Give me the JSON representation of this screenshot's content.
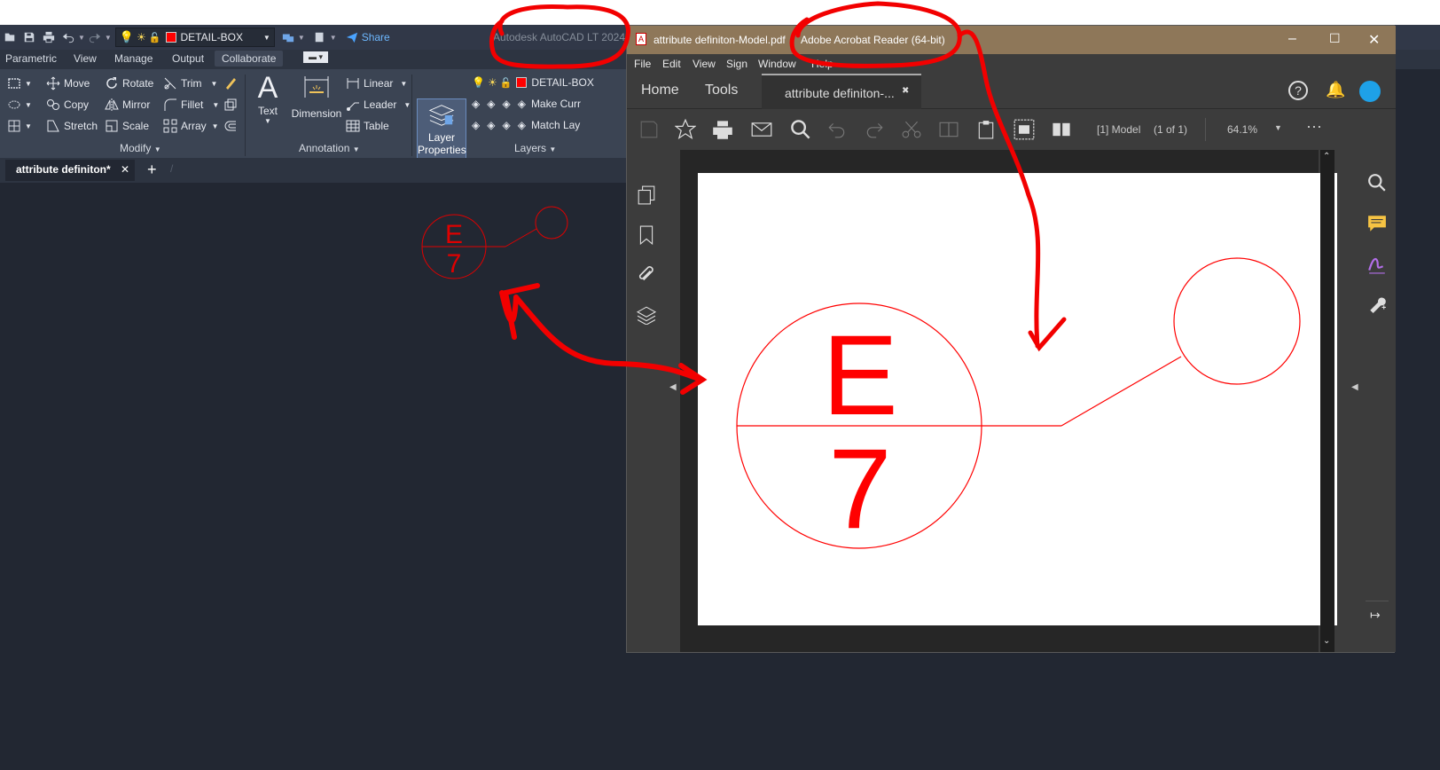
{
  "autocad": {
    "layer_name": "DETAIL-BOX",
    "share_label": "Share",
    "window_title": "Autodesk AutoCAD LT 2024",
    "tabs": [
      "Parametric",
      "View",
      "Manage",
      "Output",
      "Collaborate"
    ],
    "modify": {
      "move": "Move",
      "rotate": "Rotate",
      "trim": "Trim",
      "copy": "Copy",
      "mirror": "Mirror",
      "fillet": "Fillet",
      "stretch": "Stretch",
      "scale": "Scale",
      "array": "Array",
      "panel_title": "Modify"
    },
    "annotation": {
      "text": "Text",
      "dimension": "Dimension",
      "linear": "Linear",
      "leader": "Leader",
      "table": "Table",
      "panel_title": "Annotation"
    },
    "layers": {
      "layer_properties": "Layer Properties",
      "layer_properties_line1": "Layer",
      "layer_properties_line2": "Properties",
      "current_layer": "DETAIL-BOX",
      "make_current": "Make Curr",
      "match_layer": "Match Lay",
      "panel_title": "Layers"
    },
    "document_tab": "attribute definiton*",
    "drawing": {
      "top_text": "E",
      "bottom_text": "7"
    }
  },
  "acrobat": {
    "file_title": "attribute definiton-Model.pdf",
    "app_title": "Adobe Acrobat Reader (64-bit)",
    "menu": [
      "File",
      "Edit",
      "View",
      "Sign",
      "Window",
      "Help"
    ],
    "tabs": {
      "home": "Home",
      "tools": "Tools",
      "document": "attribute definiton-..."
    },
    "page_label": "[1] Model",
    "page_count": "(1 of 1)",
    "zoom": "64.1%",
    "drawing": {
      "top_text": "E",
      "bottom_text": "7"
    }
  },
  "colors": {
    "autocad_bg": "#222732",
    "ribbon_bg": "#3b4453",
    "acrobat_title_bg": "#8e7759",
    "annotation_red": "#f20000",
    "drawing_red": "#ff0000"
  }
}
